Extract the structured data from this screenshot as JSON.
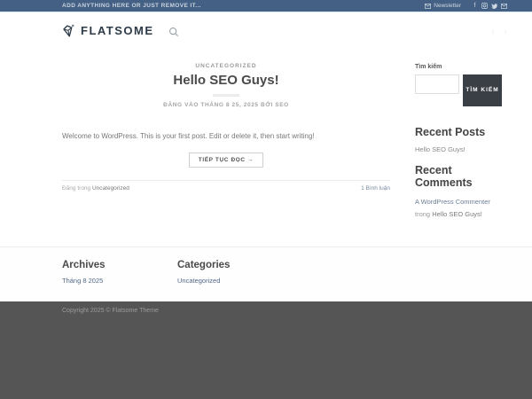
{
  "topbar": {
    "left_text": "ADD ANYTHING HERE OR JUST REMOVE IT...",
    "newsletter_label": "Newsletter",
    "facebook_glyph": "f",
    "icons": [
      "envelope-icon",
      "facebook-icon",
      "instagram-icon",
      "twitter-icon",
      "email-icon"
    ]
  },
  "header": {
    "logo_text": "FLATSOME",
    "search_icon": "magnifier-icon",
    "prev_arrow": "‹",
    "next_arrow": "›"
  },
  "post": {
    "category": "UNCATEGORIZED",
    "title": "Hello SEO Guys!",
    "meta": "ĐĂNG VÀO THÁNG 8 25, 2025 BỞI SEO",
    "excerpt": "Welcome to WordPress. This is your first post. Edit or delete it, then start writing!",
    "read_more_label": "TIẾP TỤC ĐỌC →",
    "posted_in_label": "Đăng trong ",
    "posted_in_link": "Uncategorized",
    "comments_link": "1 Bình luận"
  },
  "sidebar": {
    "search_label": "Tìm kiếm",
    "search_input_value": "",
    "search_button_label": "TÌM KIẾM",
    "recent_posts_title": "Recent Posts",
    "recent_posts": [
      "Hello SEO Guys!"
    ],
    "recent_comments_title": "Recent Comments",
    "recent_comments": [
      {
        "author": "A WordPress Commenter",
        "in_label": "trong ",
        "post": "Hello SEO Guys!"
      }
    ]
  },
  "footer": {
    "archives_title": "Archives",
    "archives": [
      "Tháng 8 2025"
    ],
    "categories_title": "Categories",
    "categories": [
      "Uncategorized"
    ],
    "copyright": "Copyright 2025 © Flatsome Theme"
  },
  "colors": {
    "topbar_bg": "#446084",
    "button_dark": "#3a3f45",
    "footer_dark": "#555555",
    "link_blue": "#52688a",
    "title_text": "#4a4a4a"
  }
}
